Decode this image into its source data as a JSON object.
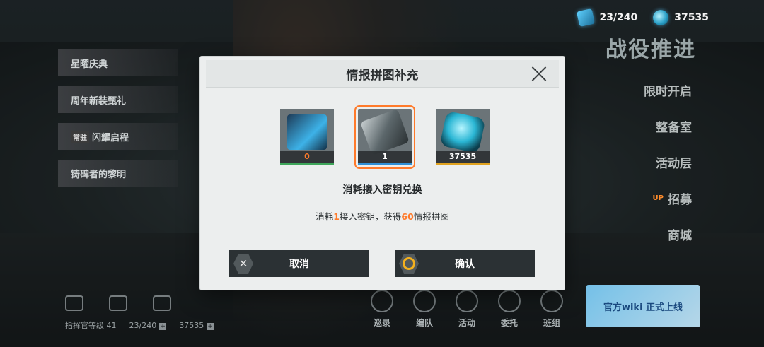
{
  "top_resources": {
    "stamina": "23/240",
    "crystal": "37535"
  },
  "campaign_title": "战役推进",
  "right_menu": {
    "item1": "限时开启",
    "item2": "整备室",
    "item3": "活动层",
    "up_tag": "UP",
    "item4": "招募",
    "item5": "商城"
  },
  "left_banners": {
    "b1": "星曜庆典",
    "b2": "周年新装甄礼",
    "b3_tag": "常驻",
    "b3": "闪耀启程",
    "b4": "铸碑者的黎明"
  },
  "bottom_stats": {
    "commander_level": "指挥官等级 41",
    "stamina": "23/240",
    "crystal": "37535"
  },
  "bottom_nav": [
    "巡录",
    "编队",
    "活动",
    "委托",
    "班组"
  ],
  "wiki_banner": "官方wiki 正式上线",
  "modal": {
    "title": "情报拼图补充",
    "items": [
      {
        "name": "intel-chip",
        "count": "0"
      },
      {
        "name": "access-key",
        "count": "1"
      },
      {
        "name": "crystal",
        "count": "37535"
      }
    ],
    "exchange_title": "消耗接入密钥兑换",
    "desc_prefix": "消耗",
    "desc_qty1": "1",
    "desc_mid": "接入密钥，获得",
    "desc_qty2": "60",
    "desc_suffix": "情报拼图",
    "cancel_label": "取消",
    "confirm_label": "确认"
  },
  "colors": {
    "accent": "#ff7a2a",
    "item1_bar": "#3ea65a",
    "item2_bar": "#2f8fd6",
    "item3_bar": "#e0a21f"
  }
}
